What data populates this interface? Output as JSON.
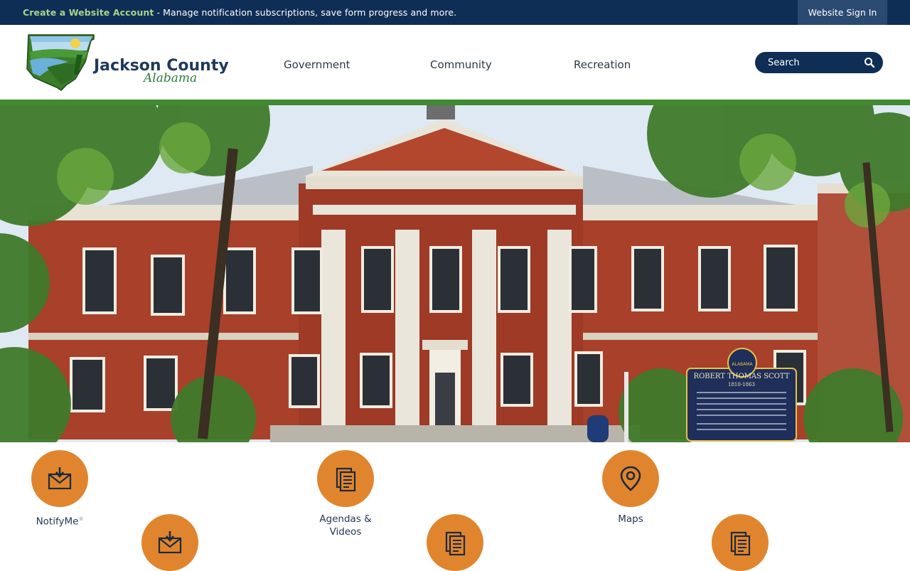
{
  "topbar": {
    "create_link": "Create a Website Account",
    "message": " - Manage notification subscriptions, save form progress and more.",
    "signin": "Website Sign In"
  },
  "logo": {
    "name": "Jackson County",
    "state": "Alabama"
  },
  "nav": [
    {
      "label": "Government"
    },
    {
      "label": "Community"
    },
    {
      "label": "Recreation"
    }
  ],
  "search": {
    "placeholder": "Search"
  },
  "hero": {
    "sign_title": "ROBERT THOMAS SCOTT",
    "sign_years": "1810-1863",
    "sign_state": "ALABAMA"
  },
  "quicklinks": [
    {
      "label": "NotifyMe",
      "sup": "®",
      "icon": "mail-download-icon"
    },
    {
      "label": "Agendas &",
      "label2": "Videos",
      "icon": "documents-icon"
    },
    {
      "label": "Maps",
      "icon": "map-pin-icon"
    },
    {
      "label": "",
      "icon": "mail-download-icon"
    },
    {
      "label": "",
      "icon": "documents-icon"
    },
    {
      "label": "",
      "icon": "documents-icon"
    }
  ],
  "colors": {
    "navy": "#0f2e56",
    "green": "#3e8a2e",
    "orange": "#e0852e"
  }
}
